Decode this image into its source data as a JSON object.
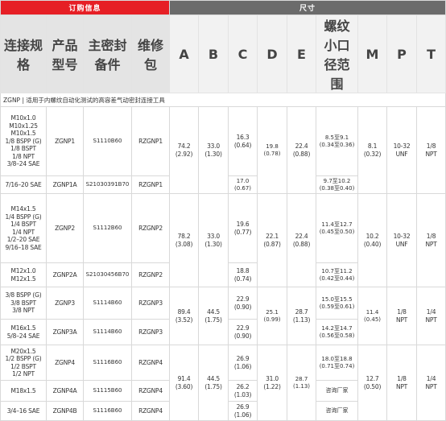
{
  "header": {
    "order_group": "订购信息",
    "size_group": "尺寸",
    "columns": [
      "连接规格",
      "产品型号",
      "主密封备件",
      "维修包",
      "A",
      "B",
      "C",
      "D",
      "E",
      "螺纹小口径范围",
      "M",
      "P",
      "T"
    ]
  },
  "note": "ZGNP | 适用于内螺纹自动化测试的高容差气动密封连接工具",
  "rows": [
    {
      "spec": "M10x1.0\nM10x1.25\nM10x1.5\n1/8 BSPP (G)\n1/8 BSPT\n1/8 NPT\n3/8–24 SAE",
      "model": "ZGNP1",
      "seal": "S1110B60",
      "kit": "RZGNP1",
      "c": "16.3\n(0.64)",
      "range": "8.5至9.1\n(0.34至0.36)"
    },
    {
      "spec": "7/16–20 SAE",
      "model": "ZGNP1A",
      "seal": "S21030391B70",
      "kit": "RZGNP1",
      "c": "17.0\n(0.67)",
      "range": "9.7至10.2\n(0.38至0.40)"
    },
    {
      "spec": "M14x1.5\n1/4 BSPP (G)\n1/4 BSPT\n1/4 NPT\n1/2–20 SAE\n9/16–18 SAE",
      "model": "ZGNP2",
      "seal": "S1112B60",
      "kit": "RZGNP2",
      "c": "19.6\n(0.77)",
      "range": "11.4至12.7\n(0.45至0.50)"
    },
    {
      "spec": "M12x1.0\nM12x1.5",
      "model": "ZGNP2A",
      "seal": "S21030456B70",
      "kit": "RZGNP2",
      "c": "18.8\n(0.74)",
      "range": "10.7至11.2\n(0.42至0.44)"
    },
    {
      "spec": "3/8 BSPP (G)\n3/8 BSPT\n3/8  NPT",
      "model": "ZGNP3",
      "seal": "S1114B60",
      "kit": "RZGNP3",
      "c": "22.9\n(0.90)",
      "range": "15.0至15.5\n(0.59至0.61)"
    },
    {
      "spec": "M16x1.5\n5/8–24 SAE",
      "model": "ZGNP3A",
      "seal": "S1114B60",
      "kit": "RZGNP3",
      "c": "22.9\n(0.90)",
      "range": "14.2至14.7\n(0.56至0.58)"
    },
    {
      "spec": "M20x1.5\n1/2 BSPP (G)\n1/2 BSPT\n1/2 NPT",
      "model": "ZGNP4",
      "seal": "S1116B60",
      "kit": "RZGNP4",
      "c": "26.9\n(1.06)",
      "range": "18.0至18.8\n(0.71至0.74)"
    },
    {
      "spec": "M18x1.5",
      "model": "ZGNP4A",
      "seal": "S1115B60",
      "kit": "RZGNP4",
      "c": "26.2\n(1.03)",
      "range": "咨询厂家"
    },
    {
      "spec": "3/4–16 SAE",
      "model": "ZGNP4B",
      "seal": "S1116B60",
      "kit": "RZGNP4",
      "c": "26.9\n(1.06)",
      "range": "咨询厂家"
    }
  ],
  "groups": [
    {
      "a": "74.2\n(2.92)",
      "b": "33.0\n(1.30)",
      "d": "19.8\n(0.78)",
      "e": "22.4\n(0.88)",
      "m": "8.1\n(0.32)",
      "p": "10-32\nUNF",
      "t": "1/8\nNPT"
    },
    {
      "a": "78.2\n(3.08)",
      "b": "33.0\n(1.30)",
      "d": "22.1\n(0.87)",
      "e": "22.4\n(0.88)",
      "m": "10.2\n(0.40)",
      "p": "10-32\nUNF",
      "t": "1/8\nNPT"
    },
    {
      "a": "89.4\n(3.52)",
      "b": "44.5\n(1.75)",
      "d": "25.1\n(0.99)",
      "e": "28.7\n(1.13)",
      "m": "11.4\n(0.45)",
      "p": "1/8\nNPT",
      "t": "1/4\nNPT"
    },
    {
      "a": "91.4\n(3.60)",
      "b": "44.5\n(1.75)",
      "d": "31.0\n(1.22)",
      "e": "28.7\n(1.13)",
      "m": "12.7\n(0.50)",
      "p": "1/8\nNPT",
      "t": "1/4\nNPT"
    }
  ]
}
